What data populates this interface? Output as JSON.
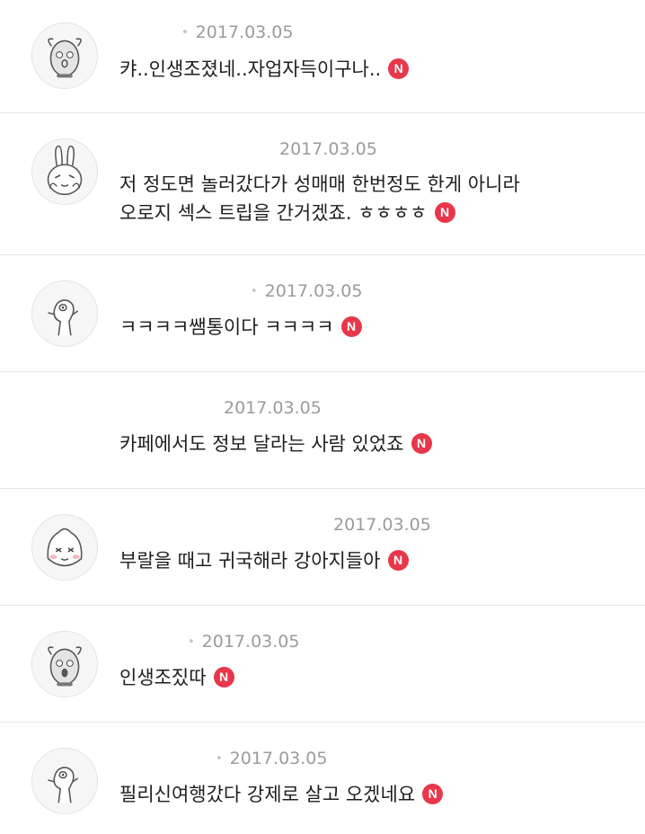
{
  "comments": [
    {
      "date": "2017.03.05",
      "text": "캬..인생조졌네..자업자득이구나..",
      "badge": "N",
      "avatar": "dog-avatar-icon"
    },
    {
      "date": "2017.03.05",
      "text": "저 정도면 놀러갔다가 성매매 한번정도 한게 아니라",
      "text2": "오로지 섹스 트립을 간거겠죠. ㅎㅎㅎㅎ",
      "badge": "N",
      "avatar": "rabbit-avatar-icon"
    },
    {
      "date": "2017.03.05",
      "text": "ㅋㅋㅋㅋ쌤통이다 ㅋㅋㅋㅋ",
      "badge": "N",
      "avatar": "muzi-avatar-icon"
    },
    {
      "date": "2017.03.05",
      "text": "카페에서도 정보 달라는 사람 있었죠",
      "badge": "N",
      "avatar": "none"
    },
    {
      "date": "2017.03.05",
      "text": "부랄을 때고 귀국해라 강아지들아",
      "badge": "N",
      "avatar": "peach-avatar-icon"
    },
    {
      "date": "2017.03.05",
      "text": "인생조짔따",
      "badge": "N",
      "avatar": "dog-avatar-icon"
    },
    {
      "date": "2017.03.05",
      "text": "필리신여행갔다 강제로 살고 오겠네요",
      "badge": "N",
      "avatar": "muzi-avatar-icon"
    }
  ]
}
